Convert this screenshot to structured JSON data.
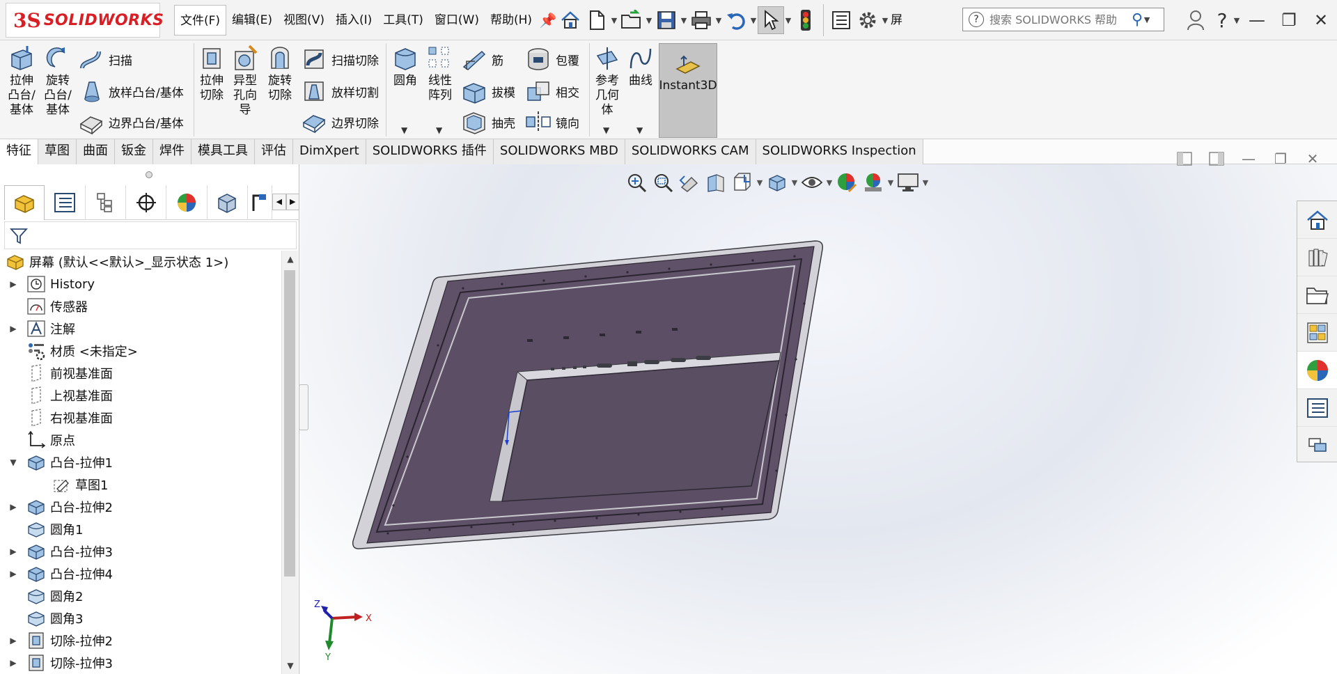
{
  "app": {
    "logo_prefix": "3S",
    "logo_name": "SOLIDWORKS"
  },
  "menu": [
    {
      "label": "文件(F)",
      "active": true
    },
    {
      "label": "编辑(E)"
    },
    {
      "label": "视图(V)"
    },
    {
      "label": "插入(I)"
    },
    {
      "label": "工具(T)"
    },
    {
      "label": "窗口(W)"
    },
    {
      "label": "帮助(H)"
    }
  ],
  "quick_tail_label": "屏",
  "help_search": {
    "placeholder": "搜索 SOLIDWORKS 帮助"
  },
  "ribbon": {
    "extrude_boss": "拉伸\n凸台/\n基体",
    "revolve_boss": "旋转\n凸台/\n基体",
    "sweep": "扫描",
    "loft_boss": "放样凸台/基体",
    "boundary_boss": "边界凸台/基体",
    "extrude_cut": "拉伸\n切除",
    "hole_wizard": "异型\n孔向\n导",
    "revolve_cut": "旋转\n切除",
    "swept_cut": "扫描切除",
    "lofted_cut": "放样切割",
    "boundary_cut": "边界切除",
    "fillet": "圆角",
    "linear_pattern": "线性\n阵列",
    "rib": "筋",
    "draft": "拔模",
    "shell": "抽壳",
    "wrap": "包覆",
    "intersect": "相交",
    "mirror": "镜向",
    "ref_geometry": "参考\n几何\n体",
    "curves": "曲线",
    "instant3d": "Instant3D"
  },
  "command_tabs": [
    {
      "label": "特征",
      "active": true
    },
    {
      "label": "草图"
    },
    {
      "label": "曲面"
    },
    {
      "label": "钣金"
    },
    {
      "label": "焊件"
    },
    {
      "label": "模具工具"
    },
    {
      "label": "评估"
    },
    {
      "label": "DimXpert"
    },
    {
      "label": "SOLIDWORKS 插件"
    },
    {
      "label": "SOLIDWORKS MBD"
    },
    {
      "label": "SOLIDWORKS CAM"
    },
    {
      "label": "SOLIDWORKS Inspection"
    }
  ],
  "tree": {
    "root": "屏幕 (默认<<默认>_显示状态 1>)",
    "nodes": [
      {
        "label": "History",
        "icon": "history-icon",
        "expandable": true
      },
      {
        "label": "传感器",
        "icon": "sensor-icon",
        "expandable": false
      },
      {
        "label": "注解",
        "icon": "annotation-icon",
        "expandable": true
      },
      {
        "label": "材质 <未指定>",
        "icon": "material-icon",
        "expandable": false
      },
      {
        "label": "前视基准面",
        "icon": "plane-icon",
        "expandable": false
      },
      {
        "label": "上视基准面",
        "icon": "plane-icon",
        "expandable": false
      },
      {
        "label": "右视基准面",
        "icon": "plane-icon",
        "expandable": false
      },
      {
        "label": "原点",
        "icon": "origin-icon",
        "expandable": false
      },
      {
        "label": "凸台-拉伸1",
        "icon": "extrude-feature-icon",
        "expandable": true,
        "expanded": true
      },
      {
        "label": "草图1",
        "icon": "sketch-icon",
        "expandable": false,
        "child": true
      },
      {
        "label": "凸台-拉伸2",
        "icon": "extrude-feature-icon",
        "expandable": true
      },
      {
        "label": "圆角1",
        "icon": "fillet-feature-icon",
        "expandable": false
      },
      {
        "label": "凸台-拉伸3",
        "icon": "extrude-feature-icon",
        "expandable": true
      },
      {
        "label": "凸台-拉伸4",
        "icon": "extrude-feature-icon",
        "expandable": true
      },
      {
        "label": "圆角2",
        "icon": "fillet-feature-icon",
        "expandable": false
      },
      {
        "label": "圆角3",
        "icon": "fillet-feature-icon",
        "expandable": false
      },
      {
        "label": "切除-拉伸2",
        "icon": "cut-feature-icon",
        "expandable": true
      },
      {
        "label": "切除-拉伸3",
        "icon": "cut-feature-icon",
        "expandable": true
      }
    ]
  },
  "triad": {
    "x": "X",
    "y": "Y",
    "z": "Z"
  },
  "colors": {
    "accent": "#2a67b8",
    "logo_red": "#d91f26",
    "model_face": "#5e5066",
    "model_edge": "#c9c9cf"
  }
}
